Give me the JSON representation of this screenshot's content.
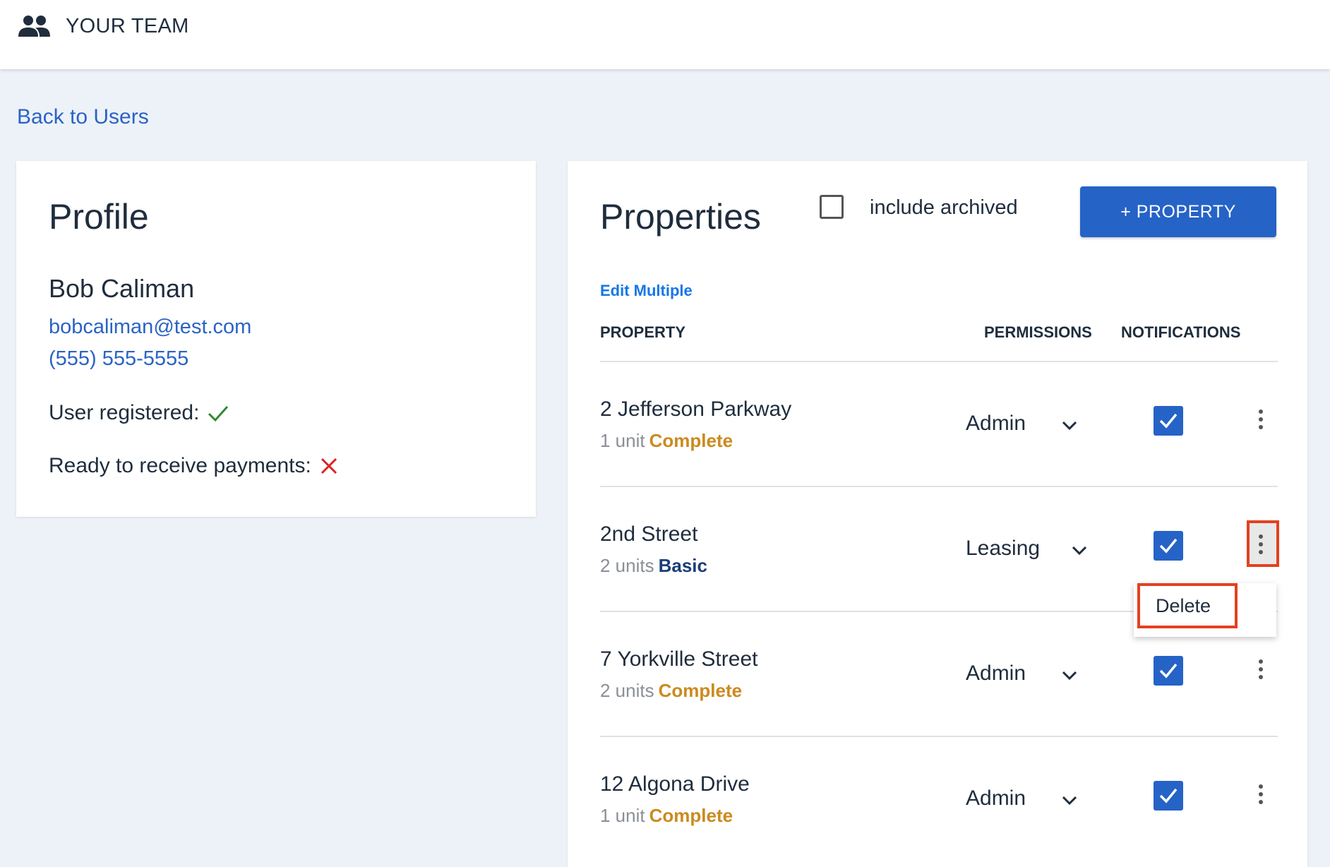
{
  "header": {
    "title": "YOUR TEAM",
    "icon": "team-icon"
  },
  "back_link": "Back to Users",
  "profile": {
    "title": "Profile",
    "name": "Bob Caliman",
    "email": "bobcaliman@test.com",
    "phone": "(555) 555-5555",
    "registered_label": "User registered:",
    "registered_status": "check",
    "payments_label": "Ready to receive payments:",
    "payments_status": "cross"
  },
  "properties": {
    "title": "Properties",
    "include_archived_label": "include archived",
    "include_archived_checked": false,
    "add_button": "+ PROPERTY",
    "edit_multiple": "Edit Multiple",
    "columns": {
      "property": "PROPERTY",
      "permissions": "PERMISSIONS",
      "notifications": "NOTIFICATIONS"
    },
    "rows": [
      {
        "name": "2 Jefferson Parkway",
        "units": "1 unit",
        "plan": "Complete",
        "permission": "Admin",
        "notifications": true
      },
      {
        "name": "2nd Street",
        "units": "2 units",
        "plan": "Basic",
        "permission": "Leasing",
        "notifications": true
      },
      {
        "name": "7 Yorkville Street",
        "units": "2 units",
        "plan": "Complete",
        "permission": "Admin",
        "notifications": true
      },
      {
        "name": "12 Algona Drive",
        "units": "1 unit",
        "plan": "Complete",
        "permission": "Admin",
        "notifications": true
      }
    ],
    "row_menu": {
      "items": [
        "Delete"
      ]
    }
  },
  "colors": {
    "accent": "#2563c7",
    "link": "#2b63c4",
    "plan_complete": "#cc8a1f",
    "plan_basic": "#1c3d7a",
    "highlight": "#e4401f",
    "success": "#2e8b2e",
    "error": "#e02020"
  }
}
